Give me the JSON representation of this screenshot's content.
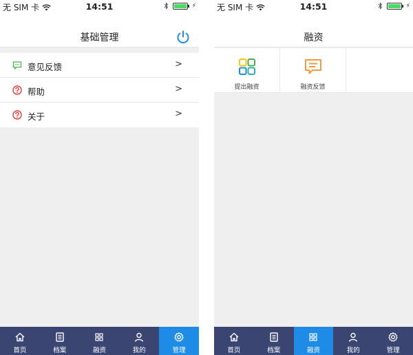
{
  "status_bar": {
    "carrier": "无 SIM 卡",
    "time": "14:51"
  },
  "left_screen": {
    "title": "基础管理",
    "menu": [
      {
        "label": "意见反馈",
        "arrow": ">"
      },
      {
        "label": "帮助",
        "arrow": ">"
      },
      {
        "label": "关于",
        "arrow": ">"
      }
    ],
    "active_tab": 4
  },
  "right_screen": {
    "title": "融资",
    "grid": [
      {
        "label": "提出融资"
      },
      {
        "label": "融资反馈"
      }
    ],
    "active_tab": 2
  },
  "tabs": [
    {
      "label": "首页",
      "icon": "home-icon"
    },
    {
      "label": "档案",
      "icon": "document-icon"
    },
    {
      "label": "融资",
      "icon": "grid-icon"
    },
    {
      "label": "我的",
      "icon": "user-icon"
    },
    {
      "label": "管理",
      "icon": "gear-icon"
    }
  ],
  "colors": {
    "tab_bar": "#3a4572",
    "tab_active": "#1e8ce6",
    "accent_blue": "#1e8ce6",
    "feedback_green": "#4caf50",
    "help_red": "#e53935",
    "battery_green": "#4cd964",
    "financing_orange": "#f39a3c"
  }
}
